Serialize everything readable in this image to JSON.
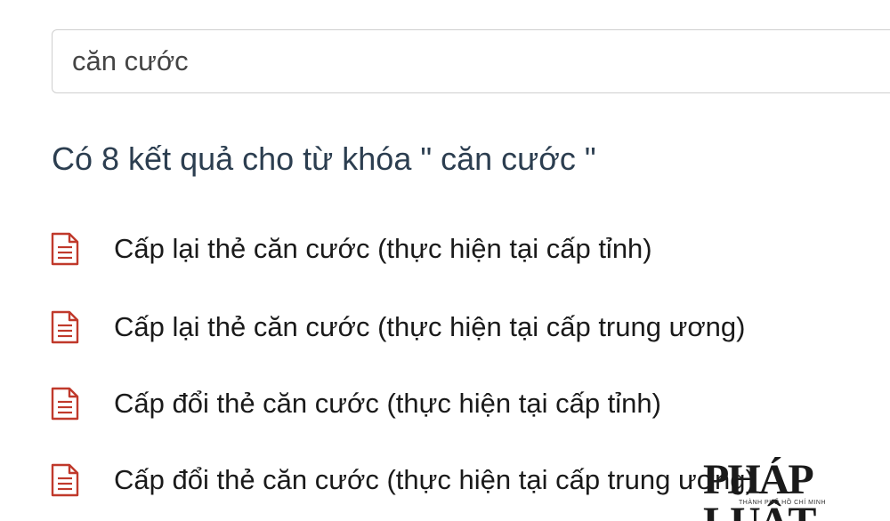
{
  "search": {
    "value": "căn cước"
  },
  "heading": "Có 8 kết quả cho từ khóa \" căn cước \"",
  "results": [
    {
      "label": "Cấp lại thẻ căn cước (thực hiện tại cấp tỉnh)"
    },
    {
      "label": "Cấp lại thẻ căn cước (thực hiện tại cấp trung ương)"
    },
    {
      "label": "Cấp đổi thẻ căn cước (thực hiện tại cấp tỉnh)"
    },
    {
      "label": "Cấp đổi thẻ căn cước (thực hiện tại cấp trung ương)"
    }
  ],
  "icons": {
    "result_icon": "document-icon",
    "icon_color": "#c0392b"
  },
  "watermark": {
    "text": "PHÁP LUẬT",
    "subtext": "THÀNH PHỐ HỒ CHÍ MINH"
  }
}
